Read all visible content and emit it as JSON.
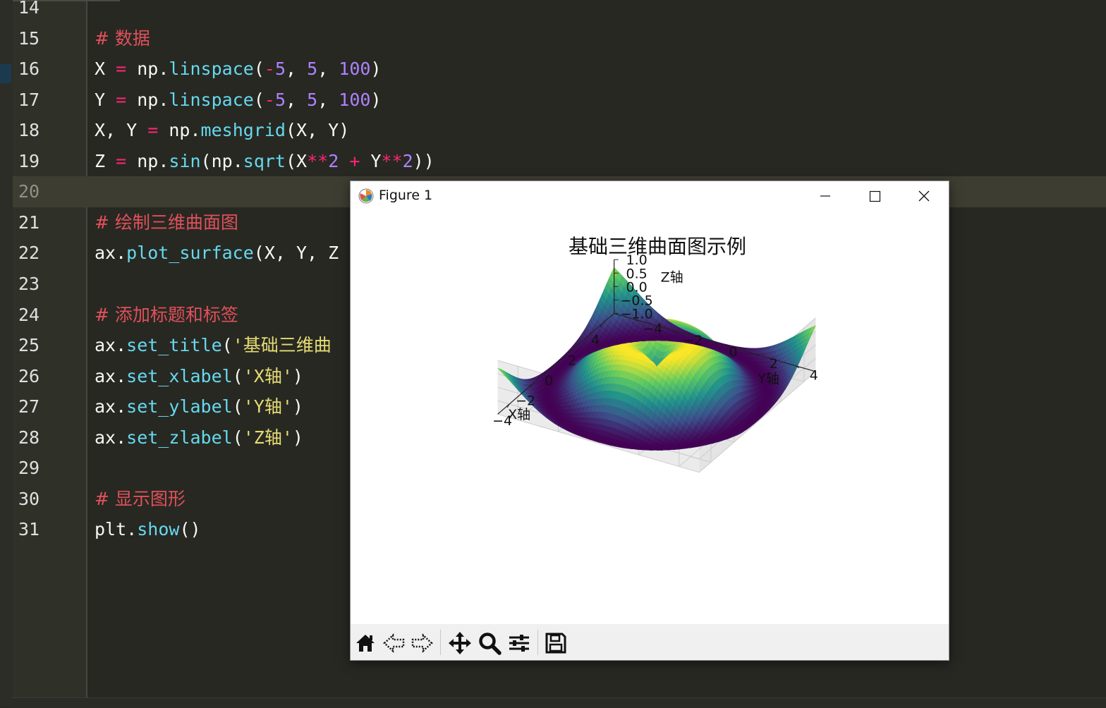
{
  "editor": {
    "current_line": "20",
    "lines": [
      {
        "num": "14"
      },
      {
        "num": "15",
        "comment": "# 数据"
      },
      {
        "num": "16",
        "t": [
          "X ",
          "=",
          " np.",
          "linspace",
          "(",
          "-",
          "5",
          ", ",
          "5",
          ", ",
          "100",
          ")"
        ]
      },
      {
        "num": "17",
        "t": [
          "Y ",
          "=",
          " np.",
          "linspace",
          "(",
          "-",
          "5",
          ", ",
          "5",
          ", ",
          "100",
          ")"
        ]
      },
      {
        "num": "18",
        "t": [
          "X, Y ",
          "=",
          " np.",
          "meshgrid",
          "(X, Y)"
        ]
      },
      {
        "num": "19",
        "t": [
          "Z ",
          "=",
          " np.",
          "sin",
          "(np.",
          "sqrt",
          "(X",
          "**",
          "2",
          " + ",
          "Y",
          "**",
          "2",
          "))"
        ]
      },
      {
        "num": "20"
      },
      {
        "num": "21",
        "comment": "# 绘制三维曲面图"
      },
      {
        "num": "22",
        "t": [
          "ax.",
          "plot_surface",
          "(X, Y, Z"
        ]
      },
      {
        "num": "23"
      },
      {
        "num": "24",
        "comment": "# 添加标题和标签"
      },
      {
        "num": "25",
        "t": [
          "ax.",
          "set_title",
          "(",
          "'基础三维曲"
        ]
      },
      {
        "num": "26",
        "t": [
          "ax.",
          "set_xlabel",
          "(",
          "'X轴'",
          ")"
        ]
      },
      {
        "num": "27",
        "t": [
          "ax.",
          "set_ylabel",
          "(",
          "'Y轴'",
          ")"
        ]
      },
      {
        "num": "28",
        "t": [
          "ax.",
          "set_zlabel",
          "(",
          "'Z轴'",
          ")"
        ]
      },
      {
        "num": "29"
      },
      {
        "num": "30",
        "comment": "# 显示图形"
      },
      {
        "num": "31",
        "t": [
          "plt.",
          "show",
          "()"
        ]
      }
    ]
  },
  "figure_window": {
    "title": "Figure 1",
    "controls": [
      "minimize-icon",
      "maximize-icon",
      "close-icon"
    ],
    "toolbar": [
      "home-icon",
      "back-icon",
      "forward-icon",
      "pan-icon",
      "zoom-icon",
      "configure-icon",
      "save-icon"
    ]
  },
  "chart_data": {
    "type": "surface3d",
    "title": "基础三维曲面图示例",
    "function": "Z = sin(sqrt(X**2 + Y**2))",
    "x": {
      "min": -5,
      "max": 5,
      "num": 100
    },
    "y": {
      "min": -5,
      "max": 5,
      "num": 100
    },
    "xlabel": "X轴",
    "ylabel": "Y轴",
    "zlabel": "Z轴",
    "xticks": [
      "−4",
      "−2",
      "0",
      "2",
      "4"
    ],
    "yticks": [
      "−4",
      "−2",
      "0",
      "2",
      "4"
    ],
    "zticks": [
      "−1.0",
      "−0.5",
      "0.0",
      "0.5",
      "1.0"
    ],
    "xlim": [
      -5,
      5
    ],
    "ylim": [
      -5,
      5
    ],
    "zlim": [
      -1,
      1
    ],
    "colormap": "viridis",
    "colormap_stops": [
      "#440154",
      "#3b528b",
      "#21918c",
      "#5ec962",
      "#fde725"
    ],
    "grid": true
  }
}
